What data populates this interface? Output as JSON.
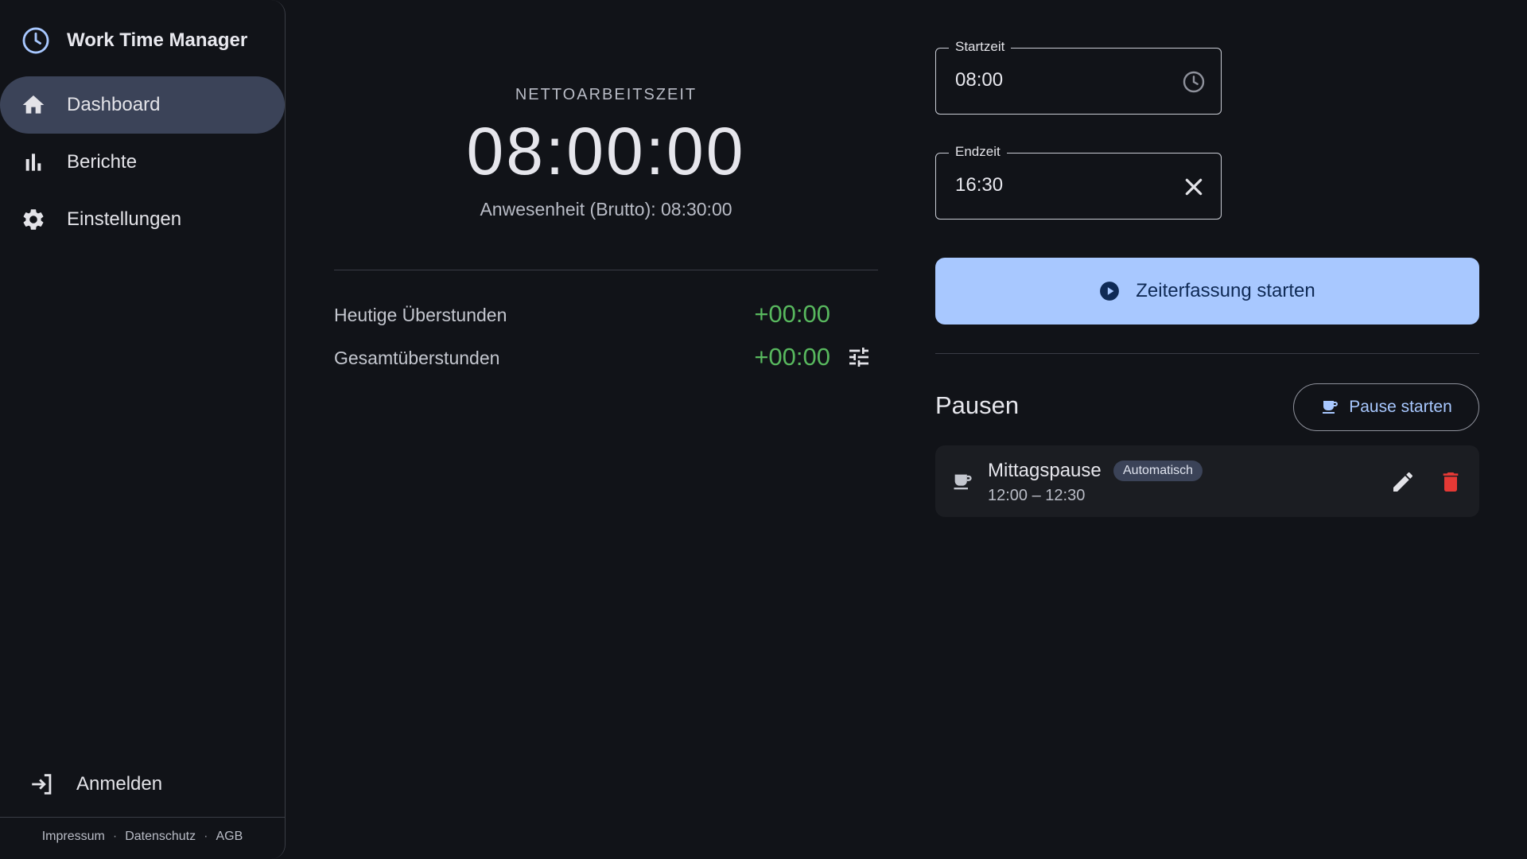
{
  "app": {
    "title": "Work Time Manager"
  },
  "sidebar": {
    "items": [
      {
        "label": "Dashboard",
        "icon": "home-icon",
        "active": true
      },
      {
        "label": "Berichte",
        "icon": "bar-chart-icon",
        "active": false
      },
      {
        "label": "Einstellungen",
        "icon": "gear-icon",
        "active": false
      }
    ],
    "login_label": "Anmelden",
    "footer_links": [
      "Impressum",
      "Datenschutz",
      "AGB"
    ],
    "footer_separator": "·"
  },
  "summary": {
    "net_label": "NETTOARBEITSZEIT",
    "net_value": "08:00:00",
    "gross_text": "Anwesenheit (Brutto): 08:30:00",
    "today_overtime_label": "Heutige Überstunden",
    "today_overtime_value": "+00:00",
    "total_overtime_label": "Gesamtüberstunden",
    "total_overtime_value": "+00:00"
  },
  "times": {
    "start_label": "Startzeit",
    "start_value": "08:00",
    "end_label": "Endzeit",
    "end_value": "16:30",
    "start_button_label": "Zeiterfassung starten"
  },
  "breaks": {
    "title": "Pausen",
    "start_button_label": "Pause starten",
    "items": [
      {
        "name": "Mittagspause",
        "badge": "Automatisch",
        "time": "12:00 – 12:30"
      }
    ]
  },
  "colors": {
    "background": "#111318",
    "active_nav": "#3b4358",
    "primary": "#a8c8ff",
    "positive": "#58b85e",
    "danger": "#e53935"
  }
}
